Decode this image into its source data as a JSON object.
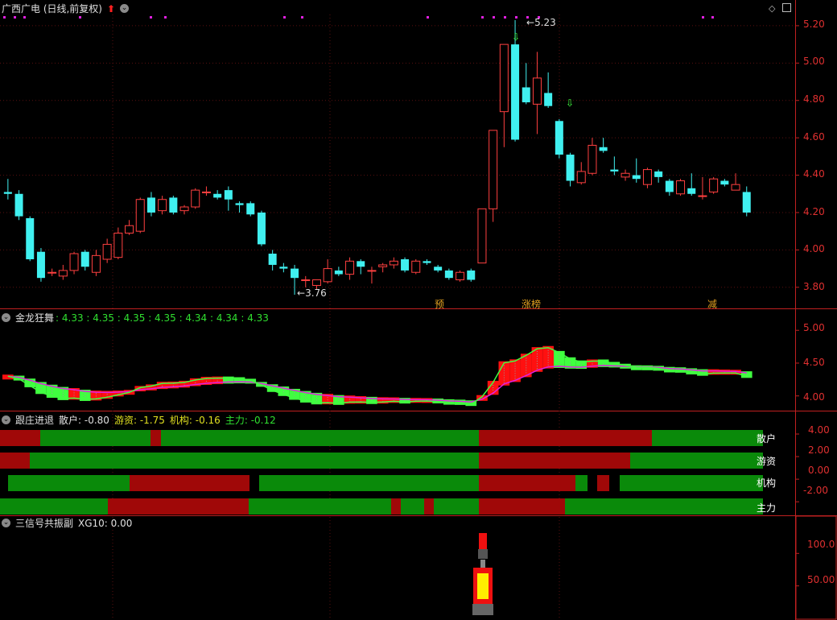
{
  "window": {
    "title": "广西广电 (日线,前复权)",
    "diamond_icon": "diamond-icon",
    "minimize_icon": "square-icon"
  },
  "main_panel": {
    "high_label": "5.23",
    "low_label": "3.76",
    "y_ticks": [
      "5.20",
      "5.00",
      "4.80",
      "4.60",
      "4.40",
      "4.20",
      "4.00",
      "3.80"
    ],
    "event_tags": [
      "预",
      "涨榜",
      "减"
    ]
  },
  "indicator1": {
    "name": "金龙狂舞",
    "values_text": ": 4.33 : 4.35 : 4.35 : 4.35 : 4.34 : 4.34 : 4.33",
    "y_ticks": [
      "5.00",
      "4.50",
      "4.00"
    ]
  },
  "indicator2": {
    "name": "跟庄进退",
    "items": [
      {
        "label": "散户:",
        "value": "-0.80",
        "color": "#e0e0e0"
      },
      {
        "label": "游资:",
        "value": "-1.75",
        "color": "#e0e020"
      },
      {
        "label": "机构:",
        "value": "-0.16",
        "color": "#e0e020"
      },
      {
        "label": "主力:",
        "value": "-0.12",
        "color": "#30e030"
      }
    ],
    "row_labels": [
      "散户",
      "游资",
      "机构",
      "主力"
    ],
    "y_ticks": [
      "4.00",
      "2.00",
      "0.00",
      "-2.00"
    ]
  },
  "indicator3": {
    "name": "三信号共振副",
    "values_text": "XG10: 0.00",
    "y_ticks": [
      "100.0",
      "50.00"
    ]
  },
  "colors": {
    "up": "#ff4040",
    "down": "#40f0f0",
    "axis": "#c02020",
    "grid": "#5a1010",
    "green_bar": "#0a8a0a",
    "red_bar": "#a00808",
    "magenta": "#e020e0",
    "lime": "#40ff40"
  },
  "chart_data": {
    "type": "candlestick",
    "y_range": [
      3.7,
      5.26
    ],
    "candles": [
      [
        4.31,
        4.3,
        4.38,
        4.27
      ],
      [
        4.3,
        4.18,
        4.32,
        4.16
      ],
      [
        4.17,
        3.95,
        4.18,
        3.94
      ],
      [
        3.99,
        3.85,
        4.01,
        3.83
      ],
      [
        3.88,
        3.88,
        3.9,
        3.86
      ],
      [
        3.86,
        3.89,
        3.92,
        3.84
      ],
      [
        3.89,
        3.98,
        3.99,
        3.87
      ],
      [
        3.99,
        3.91,
        4.0,
        3.89
      ],
      [
        3.88,
        3.97,
        4.0,
        3.86
      ],
      [
        3.95,
        4.03,
        4.06,
        3.93
      ],
      [
        3.96,
        4.09,
        4.12,
        3.95
      ],
      [
        4.09,
        4.13,
        4.16,
        4.08
      ],
      [
        4.1,
        4.27,
        4.28,
        4.09
      ],
      [
        4.28,
        4.2,
        4.31,
        4.18
      ],
      [
        4.21,
        4.27,
        4.29,
        4.19
      ],
      [
        4.28,
        4.2,
        4.29,
        4.19
      ],
      [
        4.21,
        4.23,
        4.24,
        4.19
      ],
      [
        4.23,
        4.32,
        4.33,
        4.22
      ],
      [
        4.31,
        4.31,
        4.34,
        4.29
      ],
      [
        4.3,
        4.28,
        4.32,
        4.27
      ],
      [
        4.32,
        4.27,
        4.34,
        4.21
      ],
      [
        4.25,
        4.24,
        4.26,
        4.2
      ],
      [
        4.25,
        4.19,
        4.26,
        4.18
      ],
      [
        4.2,
        4.03,
        4.21,
        4.02
      ],
      [
        3.98,
        3.92,
        4.0,
        3.89
      ],
      [
        3.91,
        3.9,
        3.93,
        3.88
      ],
      [
        3.9,
        3.85,
        3.92,
        3.76
      ],
      [
        3.84,
        3.84,
        3.86,
        3.8
      ],
      [
        3.81,
        3.84,
        3.84,
        3.79
      ],
      [
        3.83,
        3.9,
        3.95,
        3.82
      ],
      [
        3.89,
        3.87,
        3.91,
        3.86
      ],
      [
        3.87,
        3.94,
        3.96,
        3.84
      ],
      [
        3.94,
        3.91,
        3.95,
        3.87
      ],
      [
        3.89,
        3.89,
        3.91,
        3.82
      ],
      [
        3.91,
        3.92,
        3.93,
        3.88
      ],
      [
        3.92,
        3.94,
        3.96,
        3.9
      ],
      [
        3.95,
        3.89,
        3.96,
        3.88
      ],
      [
        3.88,
        3.94,
        3.95,
        3.87
      ],
      [
        3.94,
        3.93,
        3.95,
        3.92
      ],
      [
        3.91,
        3.89,
        3.92,
        3.88
      ],
      [
        3.89,
        3.85,
        3.9,
        3.84
      ],
      [
        3.84,
        3.88,
        3.89,
        3.83
      ],
      [
        3.89,
        3.84,
        3.9,
        3.83
      ],
      [
        3.93,
        4.22,
        4.22,
        3.93
      ],
      [
        4.22,
        4.64,
        4.64,
        4.15
      ],
      [
        4.74,
        5.1,
        5.1,
        4.55
      ],
      [
        5.1,
        4.59,
        5.23,
        4.58
      ],
      [
        4.87,
        4.79,
        5.0,
        4.78
      ],
      [
        4.78,
        4.92,
        5.06,
        4.62
      ],
      [
        4.84,
        4.77,
        4.95,
        4.76
      ],
      [
        4.69,
        4.51,
        4.7,
        4.49
      ],
      [
        4.51,
        4.37,
        4.52,
        4.34
      ],
      [
        4.36,
        4.42,
        4.47,
        4.35
      ],
      [
        4.41,
        4.56,
        4.6,
        4.4
      ],
      [
        4.55,
        4.53,
        4.6,
        4.52
      ],
      [
        4.43,
        4.42,
        4.5,
        4.4
      ],
      [
        4.39,
        4.41,
        4.43,
        4.37
      ],
      [
        4.4,
        4.38,
        4.49,
        4.36
      ],
      [
        4.35,
        4.43,
        4.44,
        4.33
      ],
      [
        4.42,
        4.39,
        4.43,
        4.36
      ],
      [
        4.37,
        4.31,
        4.38,
        4.29
      ],
      [
        4.3,
        4.37,
        4.38,
        4.29
      ],
      [
        4.33,
        4.3,
        4.41,
        4.29
      ],
      [
        4.29,
        4.29,
        4.39,
        4.27
      ],
      [
        4.31,
        4.38,
        4.39,
        4.3
      ],
      [
        4.37,
        4.35,
        4.38,
        4.34
      ],
      [
        4.32,
        4.35,
        4.41,
        4.32
      ],
      [
        4.31,
        4.2,
        4.34,
        4.18
      ]
    ],
    "indicator1_range": [
      3.8,
      5.15
    ],
    "indicator2_range": [
      -3.2,
      5.0
    ],
    "indicator3_range": [
      0,
      140
    ]
  }
}
